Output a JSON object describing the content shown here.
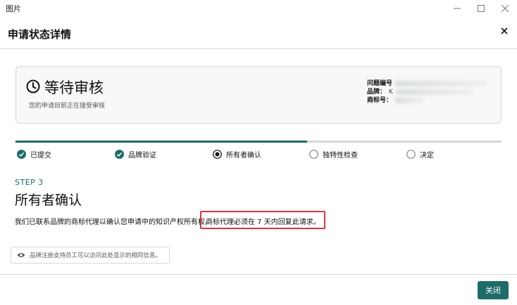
{
  "window": {
    "title": "图片"
  },
  "dialog": {
    "title": "申请状态详情",
    "status": {
      "title": "等待审核",
      "subtitle": "您的申请目前正在接受审核",
      "meta": [
        {
          "label": "问题编号",
          "value": ""
        },
        {
          "label": "品牌：",
          "value": "K"
        },
        {
          "label": "商标号：",
          "value": ""
        }
      ]
    },
    "progress": {
      "fraction": 0.6
    },
    "steps": [
      {
        "label": "已提交",
        "state": "done"
      },
      {
        "label": "品牌验证",
        "state": "done"
      },
      {
        "label": "所有者确认",
        "state": "current"
      },
      {
        "label": "独特性检查",
        "state": "pending"
      },
      {
        "label": "决定",
        "state": "pending"
      }
    ],
    "step_label": "STEP 3",
    "section_title": "所有者确认",
    "description": "我们已联系品牌的商标代理以确认您申请中的知识产权所有权。",
    "highlight_text": "商标代理必须在 7 天内回复此请求。",
    "info_text": "品牌注册支持员工可以访问此处显示的相同信息。",
    "close_button": "关闭"
  },
  "colors": {
    "accent": "#1f6b6a",
    "highlight": "#d9363e"
  }
}
